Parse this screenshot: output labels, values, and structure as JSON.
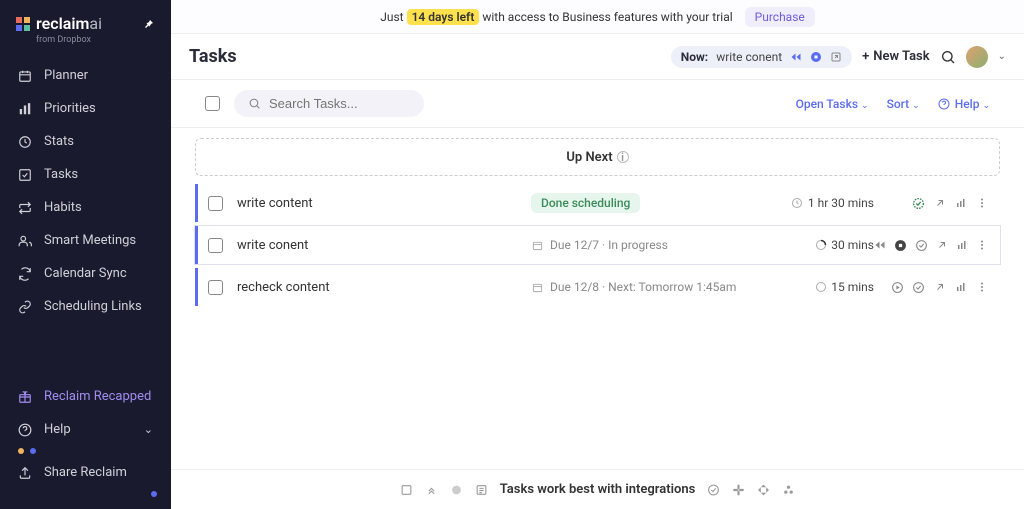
{
  "brand": {
    "name_main": "reclaim",
    "name_suffix": "ai",
    "subtitle": "from Dropbox"
  },
  "sidebar": {
    "items": [
      {
        "label": "Planner"
      },
      {
        "label": "Priorities"
      },
      {
        "label": "Stats"
      },
      {
        "label": "Tasks"
      },
      {
        "label": "Habits"
      },
      {
        "label": "Smart Meetings"
      },
      {
        "label": "Calendar Sync"
      },
      {
        "label": "Scheduling Links"
      }
    ],
    "bottom": {
      "recapped": "Reclaim Recapped",
      "help": "Help",
      "share": "Share Reclaim"
    }
  },
  "banner": {
    "prefix": "Just",
    "days": "14 days left",
    "suffix": "with access to Business features with your trial",
    "purchase": "Purchase"
  },
  "header": {
    "title": "Tasks",
    "now_label": "Now:",
    "now_value": "write conent",
    "new_task": "New Task"
  },
  "toolbar": {
    "search_placeholder": "Search Tasks...",
    "open_tasks": "Open Tasks",
    "sort": "Sort",
    "help": "Help"
  },
  "upnext": {
    "label": "Up Next"
  },
  "tasks": [
    {
      "title": "write content",
      "status_badge": "Done scheduling",
      "meta": "",
      "duration": "1 hr 30 mins",
      "duration_icon": "clock",
      "active": false,
      "actions": [
        "check-green",
        "arrow-up-right",
        "bars",
        "dots"
      ]
    },
    {
      "title": "write conent",
      "status_badge": "",
      "meta": "Due 12/7 · In progress",
      "duration": "30 mins",
      "duration_icon": "progress",
      "active": true,
      "actions": [
        "rewind",
        "stop",
        "check",
        "arrow-up-right",
        "bars",
        "dots"
      ]
    },
    {
      "title": "recheck content",
      "status_badge": "",
      "meta": "Due 12/8 · Next: Tomorrow 1:45am",
      "duration": "15 mins",
      "duration_icon": "circle",
      "active": false,
      "actions": [
        "play",
        "check",
        "arrow-up-right",
        "bars",
        "dots"
      ]
    }
  ],
  "footer": {
    "text": "Tasks work best with integrations"
  }
}
